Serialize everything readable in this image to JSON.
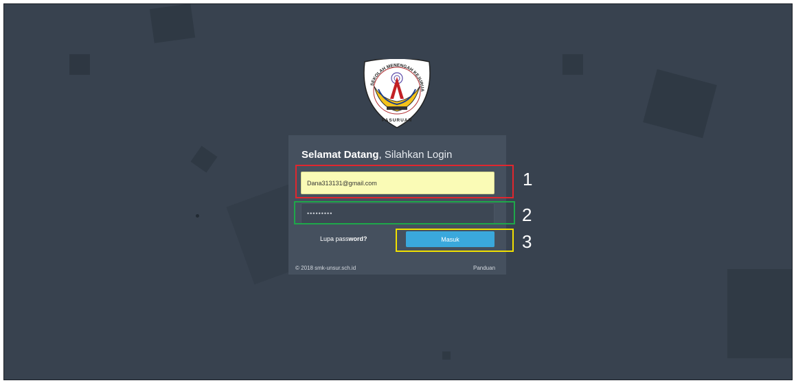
{
  "logo": {
    "ring_text": "SEKOLAH MENENGAH KEJURUAN",
    "banner_text": "PASURUAN",
    "icon": "school-crest"
  },
  "login": {
    "title_bold": "Selamat Datang",
    "title_rest": ", Silahkan Login",
    "email_value": "Dana313131@gmail.com",
    "password_mask": "•••••••••",
    "forgot_label_prefix": "Lupa pass",
    "forgot_label_bold": "word?",
    "submit_label": "Masuk"
  },
  "footer": {
    "copyright": "© 2018 smk-unsur.sch.id",
    "guide_label": "Panduan"
  },
  "annotations": [
    {
      "number": "1",
      "color": "#e0262e"
    },
    {
      "number": "2",
      "color": "#1ea84a"
    },
    {
      "number": "3",
      "color": "#f2e100"
    }
  ],
  "colors": {
    "background": "#38424f",
    "card": "#45505e",
    "email_fill": "#fafbb6",
    "button": "#3aa8dc"
  }
}
